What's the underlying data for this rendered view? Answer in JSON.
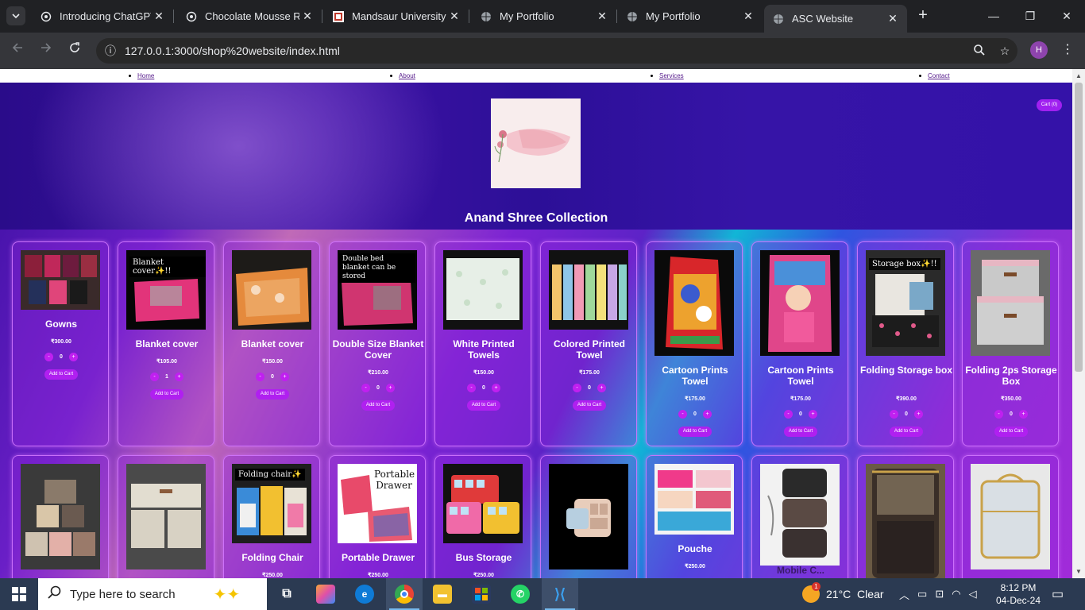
{
  "browser": {
    "tabs": [
      {
        "title": "Introducing ChatGPT",
        "icon": "chatgpt-icon"
      },
      {
        "title": "Chocolate Mousse Re",
        "icon": "chatgpt-icon"
      },
      {
        "title": "Mandsaur University",
        "icon": "university-icon"
      },
      {
        "title": "My Portfolio",
        "icon": "globe-icon"
      },
      {
        "title": "My Portfolio",
        "icon": "globe-icon"
      },
      {
        "title": "ASC Website",
        "icon": "globe-icon"
      }
    ],
    "active_tab": 5,
    "url": "127.0.0.1:3000/shop%20website/index.html",
    "profile_initial": "H"
  },
  "site": {
    "nav": [
      "Home",
      "About",
      "Services",
      "Contact"
    ],
    "cart_label": "Cart (0)",
    "logo_text": "Anand Shree Collection",
    "title": "Anand Shree Collection",
    "add_label": "Add to Cart"
  },
  "products": [
    {
      "name": "Gowns",
      "price": "₹300.00",
      "qty": "0",
      "image": "gowns"
    },
    {
      "name": "Blanket cover",
      "price": "₹105.00",
      "qty": "1",
      "image": "blanket-pink",
      "badge": "Blanket cover✨!!"
    },
    {
      "name": "Blanket cover",
      "price": "₹150.00",
      "qty": "0",
      "image": "blanket-orange"
    },
    {
      "name": "Double Size Blanket Cover",
      "price": "₹210.00",
      "qty": "0",
      "image": "blanket-double",
      "badge": "Double bed blanket can be stored"
    },
    {
      "name": "White Printed Towels",
      "price": "₹150.00",
      "qty": "0",
      "image": "towels-white"
    },
    {
      "name": "Colored Printed Towel",
      "price": "₹175.00",
      "qty": "0",
      "image": "towels-colored"
    },
    {
      "name": "Cartoon Prints Towel",
      "price": "₹175.00",
      "qty": "0",
      "image": "towel-cartoon-red"
    },
    {
      "name": "Cartoon Prints Towel",
      "price": "₹175.00",
      "qty": "0",
      "image": "towel-cartoon-pink"
    },
    {
      "name": "Folding Storage box",
      "price": "₹390.00",
      "qty": "0",
      "image": "storage-box",
      "badge": "Storage box✨!!"
    },
    {
      "name": "Folding 2ps Storage Box",
      "price": "₹350.00",
      "qty": "0",
      "image": "storage-2ps"
    },
    {
      "name": "",
      "price": "",
      "qty": "",
      "image": "storage-baskets"
    },
    {
      "name": "",
      "price": "",
      "qty": "",
      "image": "drawer-box"
    },
    {
      "name": "Folding Chair",
      "price": "₹250.00",
      "qty": "",
      "image": "folding-chair",
      "badge": "Folding chair✨"
    },
    {
      "name": "Portable Drawer",
      "price": "₹250.00",
      "qty": "",
      "image": "portable-drawer",
      "badge": "Portable Drawer"
    },
    {
      "name": "Bus Storage",
      "price": "₹250.00",
      "qty": "",
      "image": "bus-storage"
    },
    {
      "name": "",
      "price": "",
      "qty": "",
      "image": "jewelry-box"
    },
    {
      "name": "Pouche",
      "price": "₹250.00",
      "qty": "",
      "image": "pouches"
    },
    {
      "name": "Mobile C...",
      "price": "",
      "qty": "",
      "image": "mobile-cover"
    },
    {
      "name": "",
      "price": "",
      "qty": "",
      "image": "travel-kit"
    },
    {
      "name": "",
      "price": "",
      "qty": "",
      "image": "transparent-bag"
    }
  ],
  "taskbar": {
    "search_placeholder": "Type here to search",
    "weather": "21°C  Clear",
    "time": "8:12 PM",
    "date": "04-Dec-24",
    "weather_badge": "1"
  }
}
